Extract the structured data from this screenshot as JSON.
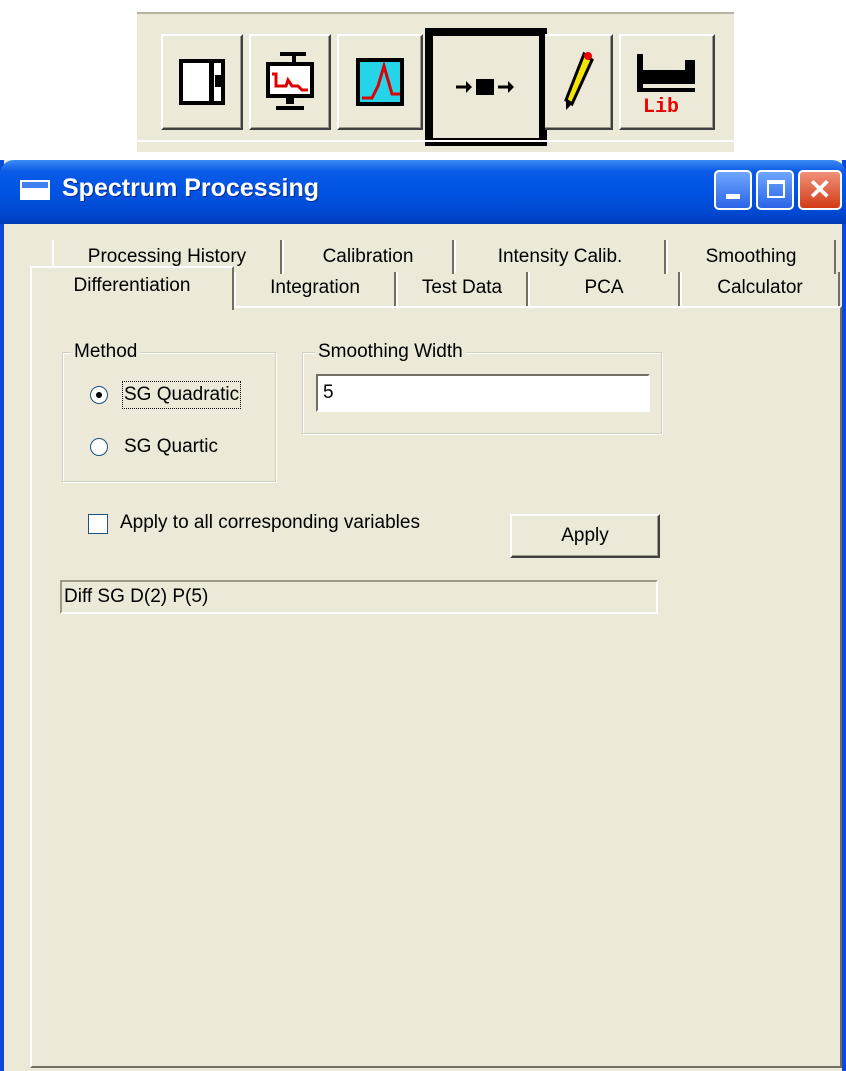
{
  "toolbar": {
    "buttons": [
      {
        "name": "panel-view-icon",
        "selected": false
      },
      {
        "name": "spectrum-trace-icon",
        "selected": false
      },
      {
        "name": "peak-plot-icon",
        "selected": false
      },
      {
        "name": "process-arrow-icon",
        "selected": true
      },
      {
        "name": "pen-edit-icon",
        "selected": false
      },
      {
        "name": "library-icon",
        "selected": false,
        "label": "Lib"
      }
    ]
  },
  "window": {
    "title": "Spectrum Processing",
    "controls": [
      "minimize",
      "maximize",
      "close"
    ]
  },
  "tabs": {
    "row_back": [
      "Processing History",
      "Calibration",
      "Intensity Calib.",
      "Smoothing"
    ],
    "row_front": [
      "Differentiation",
      "Integration",
      "Test Data",
      "PCA",
      "Calculator"
    ],
    "active": "Differentiation"
  },
  "method": {
    "title": "Method",
    "options": [
      "SG Quadratic",
      "SG Quartic"
    ],
    "selected": "SG Quadratic"
  },
  "smoothing": {
    "title": "Smoothing Width",
    "value": "5"
  },
  "apply_all": {
    "label": "Apply to all corresponding variables",
    "checked": false
  },
  "apply_button": "Apply",
  "status": "Diff SG D(2) P(5)"
}
